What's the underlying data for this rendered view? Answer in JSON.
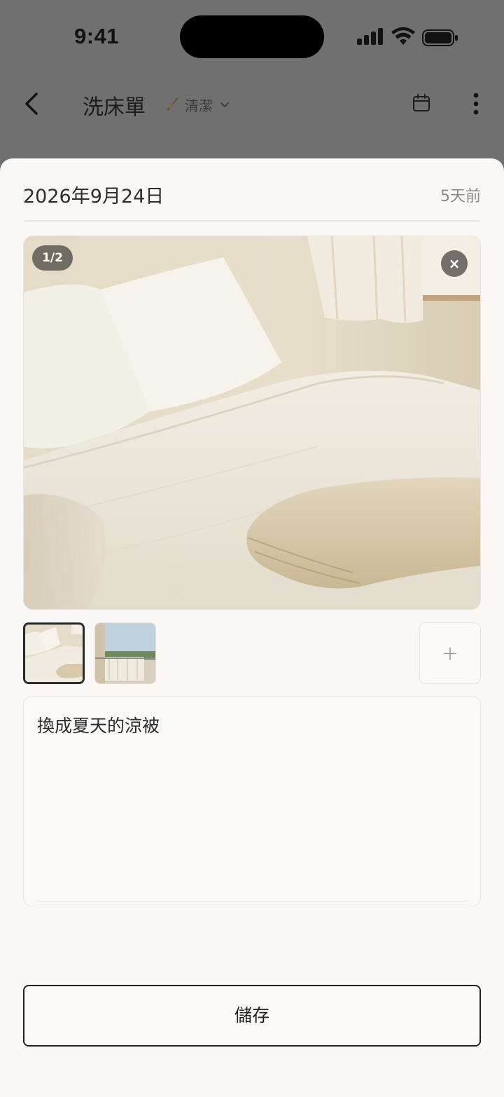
{
  "status_bar": {
    "time": "9:41"
  },
  "nav": {
    "title": "洗床單",
    "category": "清潔"
  },
  "entry": {
    "date": "2026年9月24日",
    "relative_time": "5天前",
    "photo_counter": "1/2",
    "close_label": "×",
    "add_label": "+",
    "note": "換成夏天的涼被"
  },
  "actions": {
    "save_label": "儲存"
  }
}
